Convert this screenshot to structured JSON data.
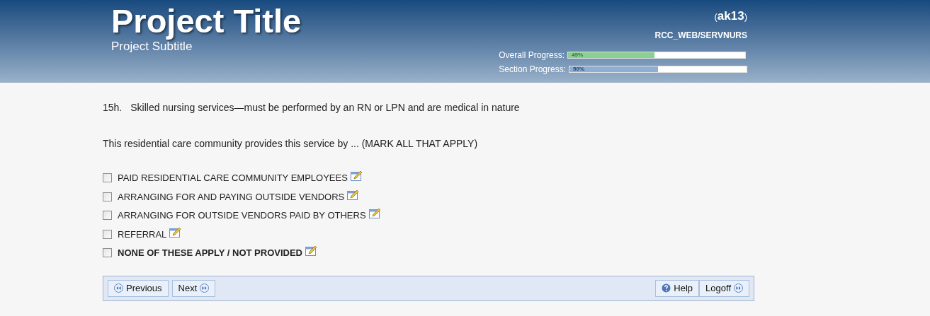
{
  "header": {
    "title": "Project Title",
    "subtitle": "Project Subtitle",
    "user_open": "(",
    "user": "ak13",
    "user_close": ")",
    "path": "RCC_WEB/SERVNURS",
    "progress": [
      {
        "label": "Overall Progress:",
        "reading": "49%",
        "level": 0.49,
        "color": "#8ccf94"
      },
      {
        "label": "Section Progress:",
        "reading": "50%",
        "level": 0.5,
        "color": "#8eaed3"
      }
    ]
  },
  "question": {
    "number": "15h.",
    "text": "Skilled nursing services—must be performed by an RN or LPN and are medical in nature",
    "instruction": "This residential care community provides this service by ... (MARK ALL THAT APPLY)",
    "options": [
      {
        "label": "PAID RESIDENTIAL CARE COMMUNITY EMPLOYEES",
        "checked": false,
        "kind": "option"
      },
      {
        "label": "ARRANGING FOR AND PAYING OUTSIDE VENDORS",
        "checked": false,
        "kind": "option"
      },
      {
        "label": "ARRANGING FOR OUTSIDE VENDORS PAID BY OTHERS",
        "checked": false,
        "kind": "option"
      },
      {
        "label": "REFERRAL",
        "checked": false,
        "kind": "option"
      },
      {
        "label": "NONE OF THESE APPLY / NOT PROVIDED",
        "checked": false,
        "kind": "exclusive"
      }
    ]
  },
  "nav": {
    "left": [
      {
        "label": "Previous",
        "kind": "back"
      },
      {
        "label": "Next",
        "kind": "forward"
      }
    ],
    "right": [
      {
        "label": "Help",
        "kind": "help"
      },
      {
        "label": "Logoff",
        "kind": "forward"
      }
    ]
  }
}
